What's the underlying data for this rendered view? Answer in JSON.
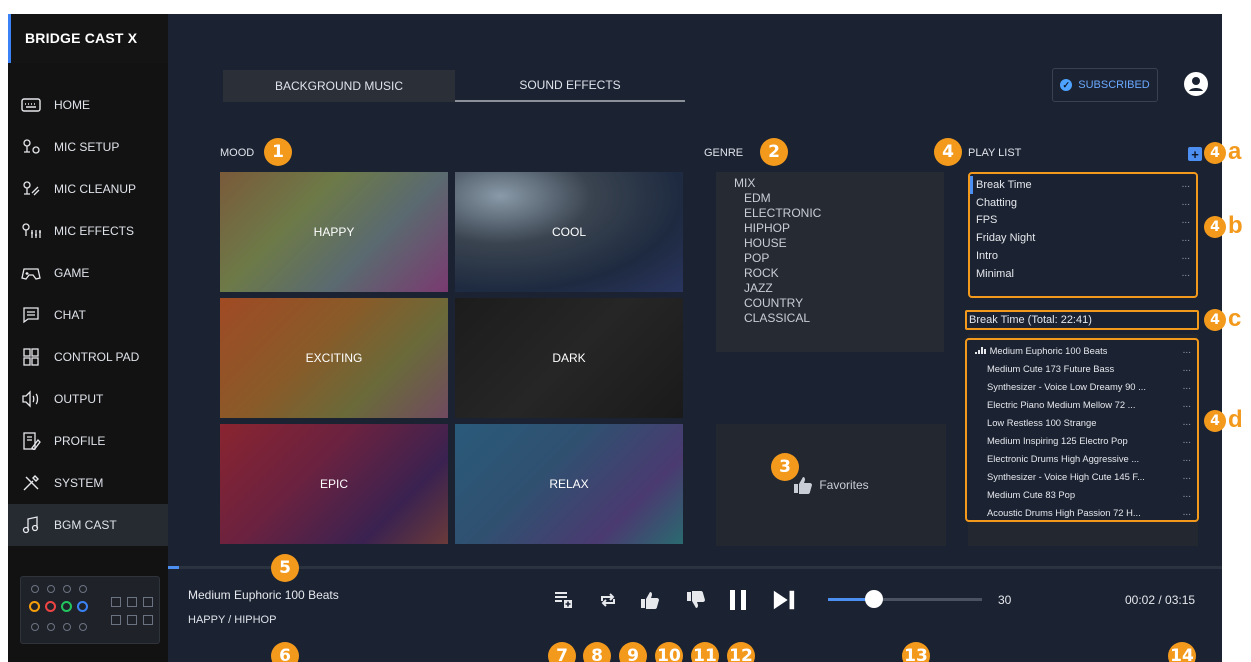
{
  "app": {
    "title": "BRIDGE CAST X"
  },
  "sidebar": {
    "items": [
      {
        "label": "HOME",
        "icon": "keyboard-icon"
      },
      {
        "label": "MIC SETUP",
        "icon": "mic-settings-icon"
      },
      {
        "label": "MIC CLEANUP",
        "icon": "mic-cleanup-icon"
      },
      {
        "label": "MIC EFFECTS",
        "icon": "mic-effects-icon"
      },
      {
        "label": "GAME",
        "icon": "gamepad-icon"
      },
      {
        "label": "CHAT",
        "icon": "chat-icon"
      },
      {
        "label": "CONTROL PAD",
        "icon": "grid-icon"
      },
      {
        "label": "OUTPUT",
        "icon": "speaker-icon"
      },
      {
        "label": "PROFILE",
        "icon": "profile-icon"
      },
      {
        "label": "SYSTEM",
        "icon": "tools-icon"
      },
      {
        "label": "BGM CAST",
        "icon": "music-note-icon",
        "active": true
      }
    ]
  },
  "tabs": [
    {
      "label": "BACKGROUND MUSIC",
      "active": true
    },
    {
      "label": "SOUND EFFECTS",
      "active": false
    }
  ],
  "header": {
    "subscribed_label": "SUBSCRIBED"
  },
  "mood": {
    "label": "MOOD",
    "tiles": [
      {
        "label": "HAPPY"
      },
      {
        "label": "COOL"
      },
      {
        "label": "EXCITING"
      },
      {
        "label": "DARK"
      },
      {
        "label": "EPIC"
      },
      {
        "label": "RELAX"
      }
    ]
  },
  "genre": {
    "label": "GENRE",
    "items": [
      "MIX",
      "EDM",
      "ELECTRONIC",
      "HIPHOP",
      "HOUSE",
      "POP",
      "ROCK",
      "JAZZ",
      "COUNTRY",
      "CLASSICAL"
    ]
  },
  "favorites": {
    "label": "Favorites"
  },
  "playlist": {
    "label": "PLAY LIST",
    "lists": [
      "Break Time",
      "Chatting",
      "FPS",
      "Friday Night",
      "Intro",
      "Minimal"
    ],
    "more": "...",
    "total": "Break Time (Total: 22:41)",
    "tracks": [
      "Medium Euphoric 100 Beats",
      "Medium Cute 173 Future Bass",
      "Synthesizer - Voice Low Dreamy 90 ...",
      "Electric Piano Medium Mellow 72 ...",
      "Low Restless 100 Strange",
      "Medium Inspiring 125 Electro Pop",
      "Electronic Drums High Aggressive ...",
      "Synthesizer - Voice High Cute 145 F...",
      "Medium Cute 83 Pop",
      "Acoustic Drums High Passion 72 H..."
    ]
  },
  "player": {
    "title": "Medium Euphoric 100 Beats",
    "subtitle": "HAPPY / HIPHOP",
    "volume": "30",
    "volume_level": 0.3,
    "progress": 0.01,
    "time": "00:02 / 03:15"
  },
  "annotations": {
    "n1": "1",
    "n2": "2",
    "n3": "3",
    "n4": "4",
    "n5": "5",
    "n6": "6",
    "n7": "7",
    "n8": "8",
    "n9": "9",
    "n10": "10",
    "n11": "11",
    "n12": "12",
    "n13": "13",
    "n14": "14",
    "a": "a",
    "b": "b",
    "c": "c",
    "d": "d"
  },
  "colors": {
    "accent": "#4d8ff0",
    "callout": "#f39a1d",
    "background": "#1b2232",
    "sidebar": "#121212"
  }
}
